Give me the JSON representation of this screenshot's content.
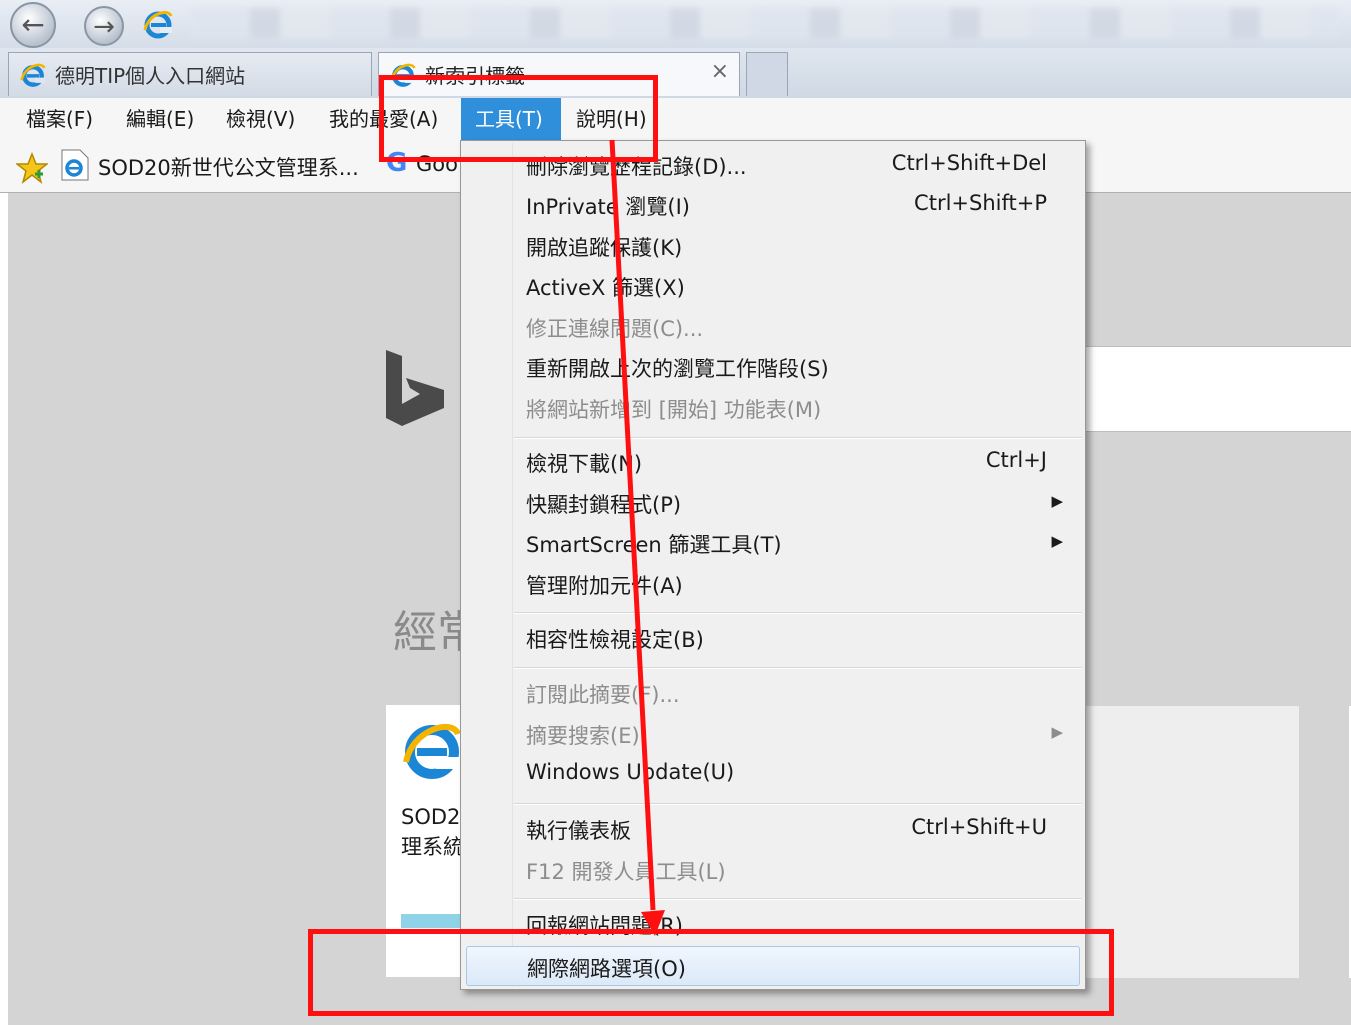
{
  "browser": {
    "tabs": [
      {
        "title": "德明TIP個人入口網站"
      },
      {
        "title": "新索引標籤",
        "close": "×"
      }
    ]
  },
  "menubar": {
    "items": [
      "檔案(F)",
      "編輯(E)",
      "檢視(V)",
      "我的最愛(A)",
      "工具(T)",
      "說明(H)"
    ],
    "active": "工具(T)"
  },
  "favorites": {
    "items": [
      {
        "label": "SOD20新世代公文管理系..."
      },
      {
        "label": "Goo"
      }
    ]
  },
  "page": {
    "frequent_heading": "經常",
    "tile_text": "SOD2\n理系統"
  },
  "tools_menu": {
    "items": [
      {
        "label": "刪除瀏覽歷程記錄(D)...",
        "shortcut": "Ctrl+Shift+Del"
      },
      {
        "label": "InPrivate 瀏覽(I)",
        "shortcut": "Ctrl+Shift+P"
      },
      {
        "label": "開啟追蹤保護(K)"
      },
      {
        "label": "ActiveX 篩選(X)"
      },
      {
        "label": "修正連線問題(C)...",
        "disabled": true
      },
      {
        "label": "重新開啟上次的瀏覽工作階段(S)"
      },
      {
        "label": "將網站新增到 [開始] 功能表(M)",
        "disabled": true
      },
      {
        "label": "檢視下載(N)",
        "shortcut": "Ctrl+J"
      },
      {
        "label": "快顯封鎖程式(P)",
        "submenu": "▶"
      },
      {
        "label": "SmartScreen 篩選工具(T)",
        "submenu": "▶"
      },
      {
        "label": "管理附加元件(A)"
      },
      {
        "label": "相容性檢視設定(B)"
      },
      {
        "label": "訂閱此摘要(F)...",
        "disabled": true
      },
      {
        "label": "摘要搜索(E)",
        "disabled": true,
        "submenu": "▶"
      },
      {
        "label": "Windows Update(U)"
      },
      {
        "label": "執行儀表板",
        "shortcut": "Ctrl+Shift+U"
      },
      {
        "label": "F12 開發人員工具(L)",
        "disabled": true
      },
      {
        "label": "回報網站問題(R)"
      },
      {
        "label": "網際網路選項(O)",
        "highlighted": true
      }
    ]
  },
  "colors": {
    "annotation": "#ff1010",
    "menu_active": "#2f8fdb"
  }
}
